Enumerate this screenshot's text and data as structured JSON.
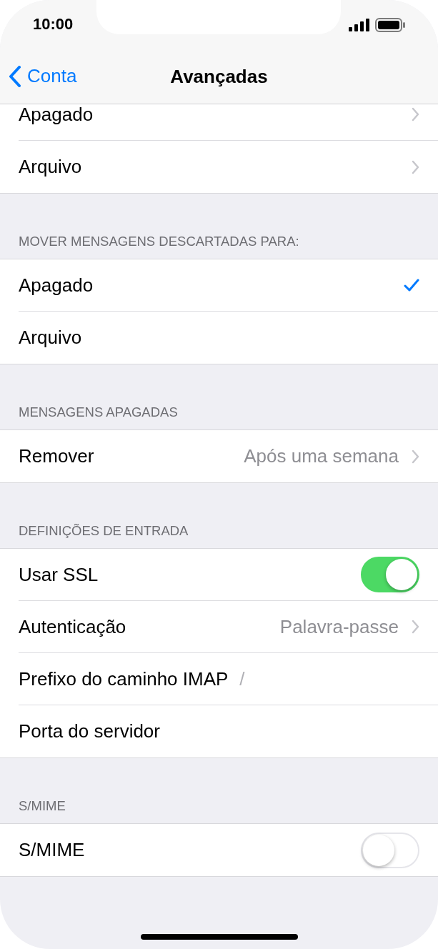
{
  "status_bar": {
    "time": "10:00"
  },
  "nav": {
    "back": "Conta",
    "title": "Avançadas"
  },
  "sections": [
    {
      "rows": [
        {
          "kind": "nav",
          "label": "Apagado"
        },
        {
          "kind": "nav",
          "label": "Arquivo"
        }
      ]
    },
    {
      "header": "MOVER MENSAGENS DESCARTADAS PARA:",
      "rows": [
        {
          "kind": "option",
          "label": "Apagado",
          "selected": true
        },
        {
          "kind": "option",
          "label": "Arquivo",
          "selected": false
        }
      ]
    },
    {
      "header": "MENSAGENS APAGADAS",
      "rows": [
        {
          "kind": "nav",
          "label": "Remover",
          "value": "Após uma semana"
        }
      ]
    },
    {
      "header": "DEFINIÇÕES DE ENTRADA",
      "rows": [
        {
          "kind": "toggle",
          "label": "Usar SSL",
          "on": true
        },
        {
          "kind": "nav",
          "label": "Autenticação",
          "value": "Palavra-passe"
        },
        {
          "kind": "field",
          "label": "Prefixo do caminho IMAP",
          "value": "/"
        },
        {
          "kind": "field",
          "label": "Porta do servidor"
        }
      ]
    },
    {
      "header": "S/MIME",
      "rows": [
        {
          "kind": "toggle",
          "label": "S/MIME",
          "on": false
        }
      ]
    }
  ]
}
